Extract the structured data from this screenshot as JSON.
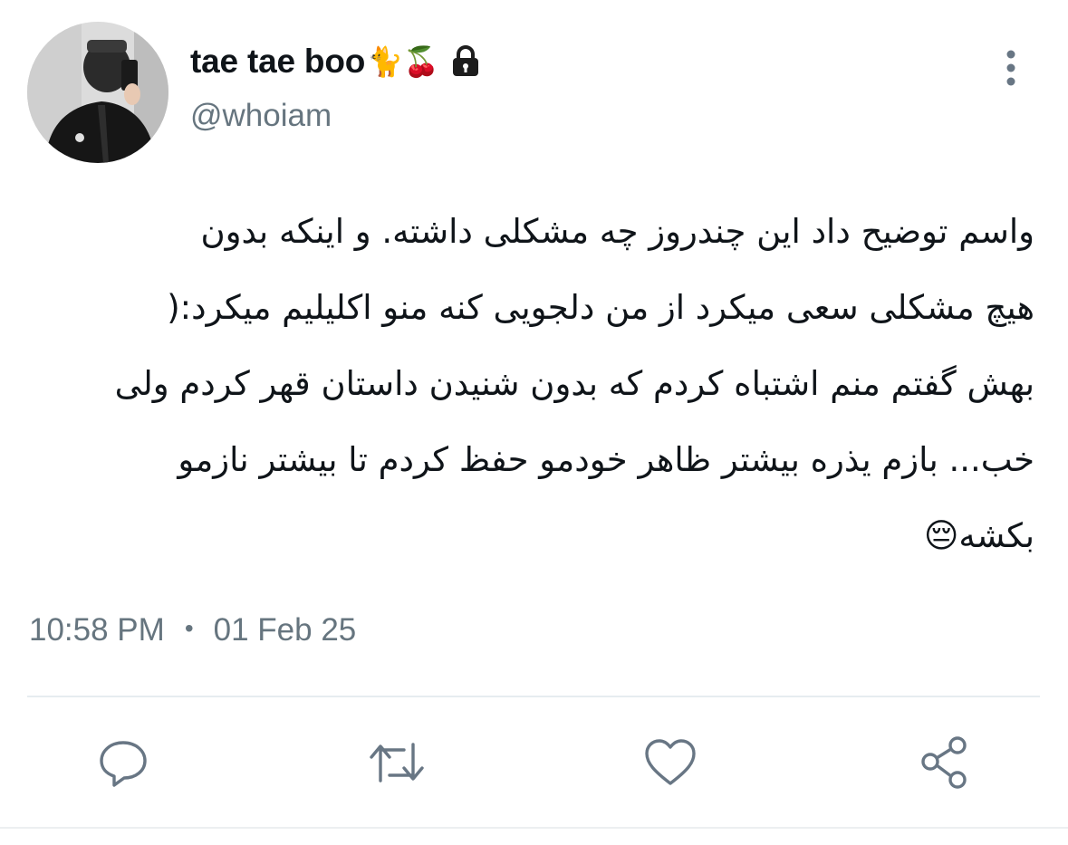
{
  "author": {
    "display_name": "tae tae boo",
    "name_emojis": "🐈🍒",
    "username": "@whoiam",
    "avatar_icon": "profile-photo",
    "protected_icon": "lock-icon"
  },
  "tweet": {
    "lines": [
      "واسم توضیح داد این چندروز چه مشکلی داشته. و اینکه بدون",
      "هیچ مشکلی سعی میکرد از من دلجویی کنه منو اکلیلیم میکرد:(",
      "بهش گفتم منم اشتباه کردم که بدون شنیدن داستان قهر کردم ولی",
      "خب... بازم یذره بیشتر ظاهر خودمو حفظ کردم تا بیشتر نازمو",
      "بکشه😔"
    ],
    "time": "10:58 PM",
    "separator": "•",
    "date": "01 Feb 25"
  },
  "actions": [
    {
      "name": "reply",
      "icon": "reply-icon"
    },
    {
      "name": "retweet",
      "icon": "retweet-icon"
    },
    {
      "name": "like",
      "icon": "heart-icon"
    },
    {
      "name": "share",
      "icon": "share-icon"
    }
  ],
  "colors": {
    "text_primary": "#0f1419",
    "text_secondary": "#66757f",
    "icon": "#687684",
    "divider": "#e6ecf0"
  }
}
